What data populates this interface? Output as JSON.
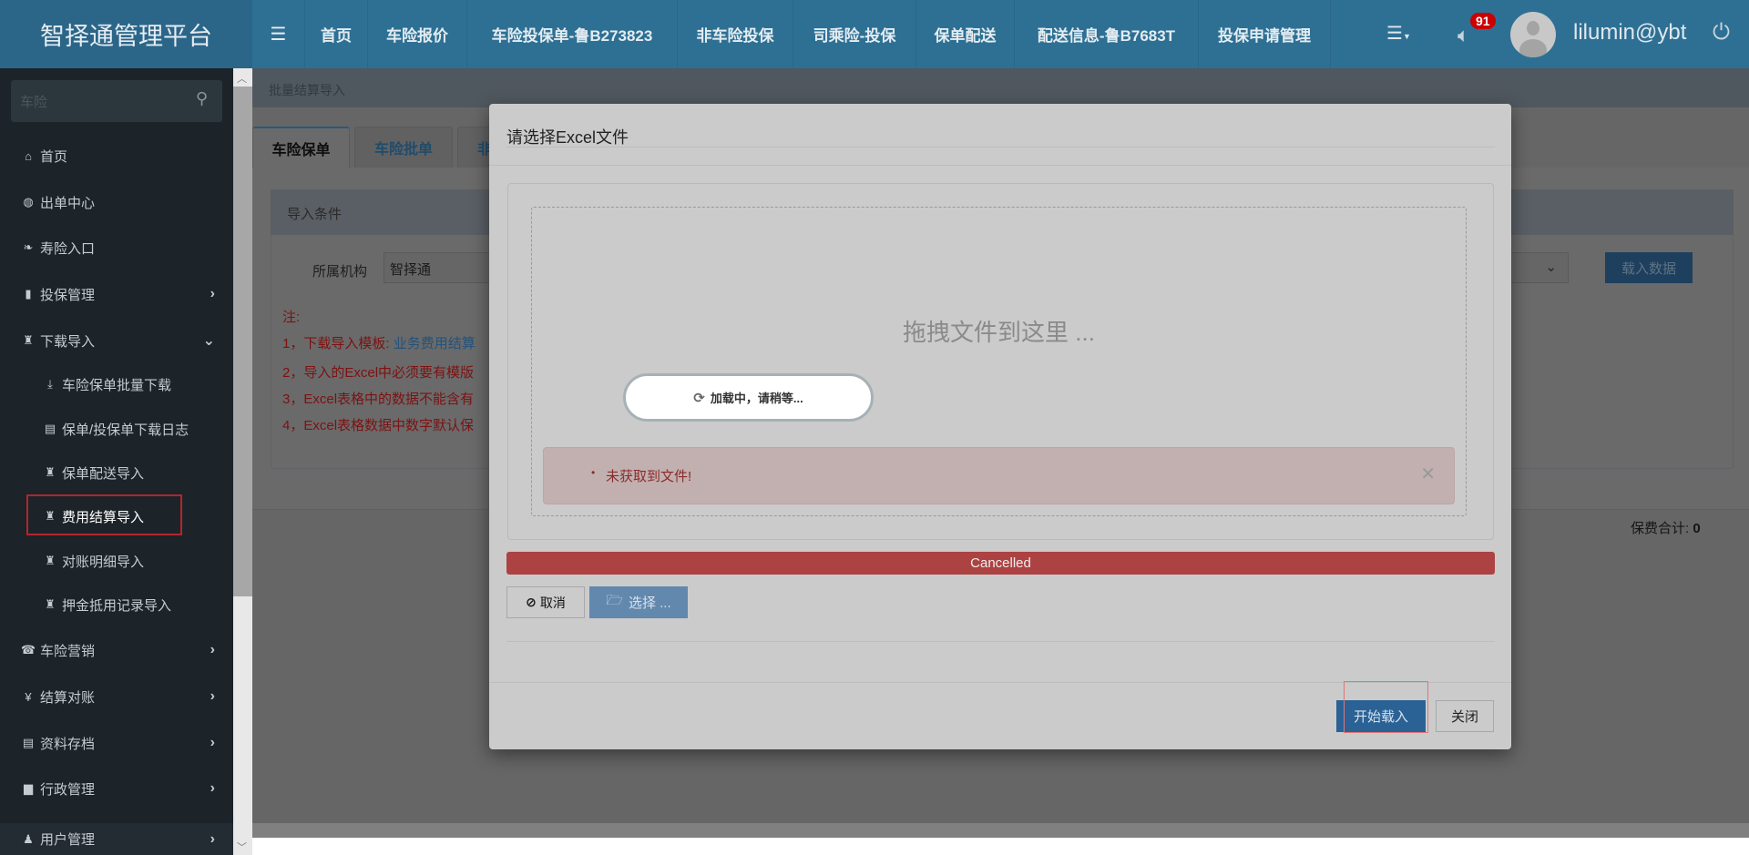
{
  "header": {
    "logo": "智择通管理平台",
    "nav": [
      "首页",
      "车险报价",
      "车险投保单-鲁B273823",
      "非车险投保",
      "司乘险-投保",
      "保单配送",
      "配送信息-鲁B7683T",
      "投保申请管理"
    ],
    "badge": "91",
    "username": "lilumin@ybt"
  },
  "sidebar": {
    "search_placeholder": "车险",
    "items": [
      {
        "label": "首页",
        "icon": "home-icon",
        "glyph": "⌂",
        "sub": false,
        "chev": ""
      },
      {
        "label": "出单中心",
        "icon": "globe-icon",
        "glyph": "◍",
        "sub": false,
        "chev": ""
      },
      {
        "label": "寿险入口",
        "icon": "leaf-icon",
        "glyph": "❧",
        "sub": false,
        "chev": ""
      },
      {
        "label": "投保管理",
        "icon": "file-icon",
        "glyph": "▮",
        "sub": false,
        "chev": "›"
      },
      {
        "label": "下载导入",
        "icon": "import-icon",
        "glyph": "♜",
        "sub": false,
        "chev": "⌄"
      },
      {
        "label": "车险保单批量下载",
        "icon": "download-icon",
        "glyph": "⤓",
        "sub": true,
        "chev": ""
      },
      {
        "label": "保单/投保单下载日志",
        "icon": "list-icon",
        "glyph": "▤",
        "sub": true,
        "chev": ""
      },
      {
        "label": "保单配送导入",
        "icon": "import-icon",
        "glyph": "♜",
        "sub": true,
        "chev": ""
      },
      {
        "label": "费用结算导入",
        "icon": "import-icon",
        "glyph": "♜",
        "sub": true,
        "chev": "",
        "active": true
      },
      {
        "label": "对账明细导入",
        "icon": "import-icon",
        "glyph": "♜",
        "sub": true,
        "chev": ""
      },
      {
        "label": "押金抵用记录导入",
        "icon": "import-icon",
        "glyph": "♜",
        "sub": true,
        "chev": ""
      },
      {
        "label": "车险营销",
        "icon": "phone-icon",
        "glyph": "☎",
        "sub": false,
        "chev": "›"
      },
      {
        "label": "结算对账",
        "icon": "yen-icon",
        "glyph": "¥",
        "sub": false,
        "chev": "›"
      },
      {
        "label": "资料存档",
        "icon": "list-icon",
        "glyph": "▤",
        "sub": false,
        "chev": "›"
      },
      {
        "label": "行政管理",
        "icon": "briefcase-icon",
        "glyph": "▆",
        "sub": false,
        "chev": "›"
      },
      {
        "label": "用户管理",
        "icon": "user-icon",
        "glyph": "♟",
        "sub": false,
        "chev": "›"
      }
    ]
  },
  "page": {
    "breadcrumb": "批量结算导入",
    "tabs": [
      "车险保单",
      "车险批单",
      "非"
    ],
    "panel_title": "导入条件",
    "org_label": "所属机构",
    "org_value": "智择通",
    "load_button": "载入数据",
    "notes": [
      "注:",
      "1，下载导入模板: ",
      "2，导入的Excel中必须要有模版",
      "3，Excel表格中的数据不能含有",
      "4，Excel表格数据中数字默认保"
    ],
    "template_link": "业务费用结算",
    "total_label": "保费合计:",
    "total_value": "0"
  },
  "modal": {
    "title": "请选择Excel文件",
    "drop_text": "拖拽文件到这里 ...",
    "loading": "加载中，请稍等...",
    "error": "未获取到文件!",
    "progress_text": "Cancelled",
    "progress_status": "cancelled",
    "cancel": "取消",
    "browse": "选择 ...",
    "start": "开始载入",
    "close": "关闭"
  }
}
